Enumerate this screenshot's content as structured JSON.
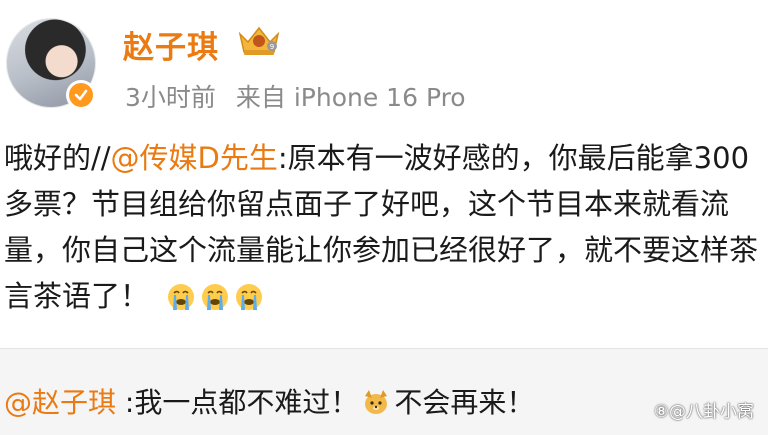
{
  "post": {
    "username": "赵子琪",
    "time": "3小时前",
    "source": "来自 iPhone 16 Pro",
    "content": {
      "lead": "哦好的//",
      "mention": "@传媒D先生",
      "body": ":原本有一波好感的，你最后能拿300多票？节目组给你留点面子了好吧，这个节目本来就看流量，你自己这个流量能让你参加已经很好了，就不要这样茶言茶语了！",
      "emojis": [
        "crying-emoji",
        "crying-emoji",
        "crying-emoji"
      ]
    },
    "icons": {
      "verified": "verified-icon",
      "vip": "crown-icon"
    }
  },
  "repost": {
    "mention": "@赵子琪",
    "text_before": " :我一点都不难过！",
    "emoji": "dog-emoji",
    "text_after": "不会再来！"
  },
  "watermark": "⑧@八卦小窝",
  "colors": {
    "accent": "#ea7a12",
    "meta": "#8a8a8a",
    "repost_bg": "#f5f5f5"
  }
}
